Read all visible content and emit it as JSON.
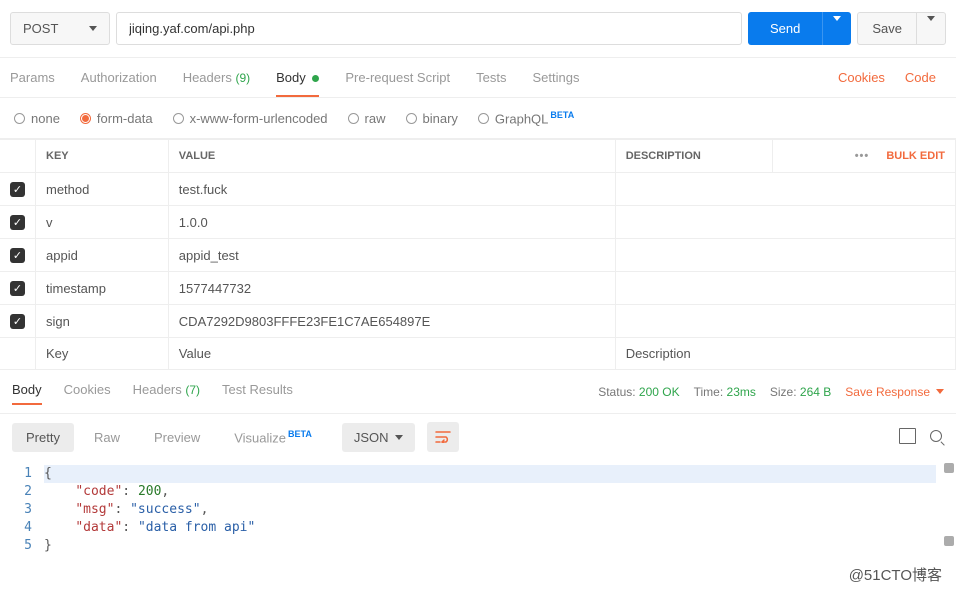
{
  "request": {
    "method": "POST",
    "url": "jiqing.yaf.com/api.php",
    "send_label": "Send",
    "save_label": "Save"
  },
  "tabs": {
    "items": [
      "Params",
      "Authorization",
      "Headers",
      "Body",
      "Pre-request Script",
      "Tests",
      "Settings"
    ],
    "headers_count": "(9)",
    "active": "Body",
    "cookies_link": "Cookies",
    "code_link": "Code"
  },
  "body_types": {
    "items": [
      "none",
      "form-data",
      "x-www-form-urlencoded",
      "raw",
      "binary",
      "GraphQL"
    ],
    "beta_label": "BETA",
    "selected": "form-data"
  },
  "form_table": {
    "headers": {
      "key": "KEY",
      "value": "VALUE",
      "description": "DESCRIPTION"
    },
    "rows": [
      {
        "checked": true,
        "key": "method",
        "value": "test.fuck",
        "description": ""
      },
      {
        "checked": true,
        "key": "v",
        "value": "1.0.0",
        "description": ""
      },
      {
        "checked": true,
        "key": "appid",
        "value": "appid_test",
        "description": ""
      },
      {
        "checked": true,
        "key": "timestamp",
        "value": "1577447732",
        "description": ""
      },
      {
        "checked": true,
        "key": "sign",
        "value": "CDA7292D9803FFFE23FE1C7AE654897E",
        "description": ""
      }
    ],
    "placeholder": {
      "key": "Key",
      "value": "Value",
      "description": "Description"
    },
    "bulk_edit": "Bulk Edit",
    "more_icon": "•••"
  },
  "response": {
    "tabs": [
      "Body",
      "Cookies",
      "Headers",
      "Test Results"
    ],
    "headers_count": "(7)",
    "active": "Body",
    "status_label": "Status:",
    "status_value": "200 OK",
    "time_label": "Time:",
    "time_value": "23ms",
    "size_label": "Size:",
    "size_value": "264 B",
    "save_response": "Save Response"
  },
  "view": {
    "modes": [
      "Pretty",
      "Raw",
      "Preview",
      "Visualize"
    ],
    "beta_label": "BETA",
    "selected": "Pretty",
    "format": "JSON"
  },
  "json_body": {
    "code_key": "\"code\"",
    "code_val": "200",
    "msg_key": "\"msg\"",
    "msg_val": "\"success\"",
    "data_key": "\"data\"",
    "data_val": "\"data from api\""
  },
  "watermark": "@51CTO博客"
}
